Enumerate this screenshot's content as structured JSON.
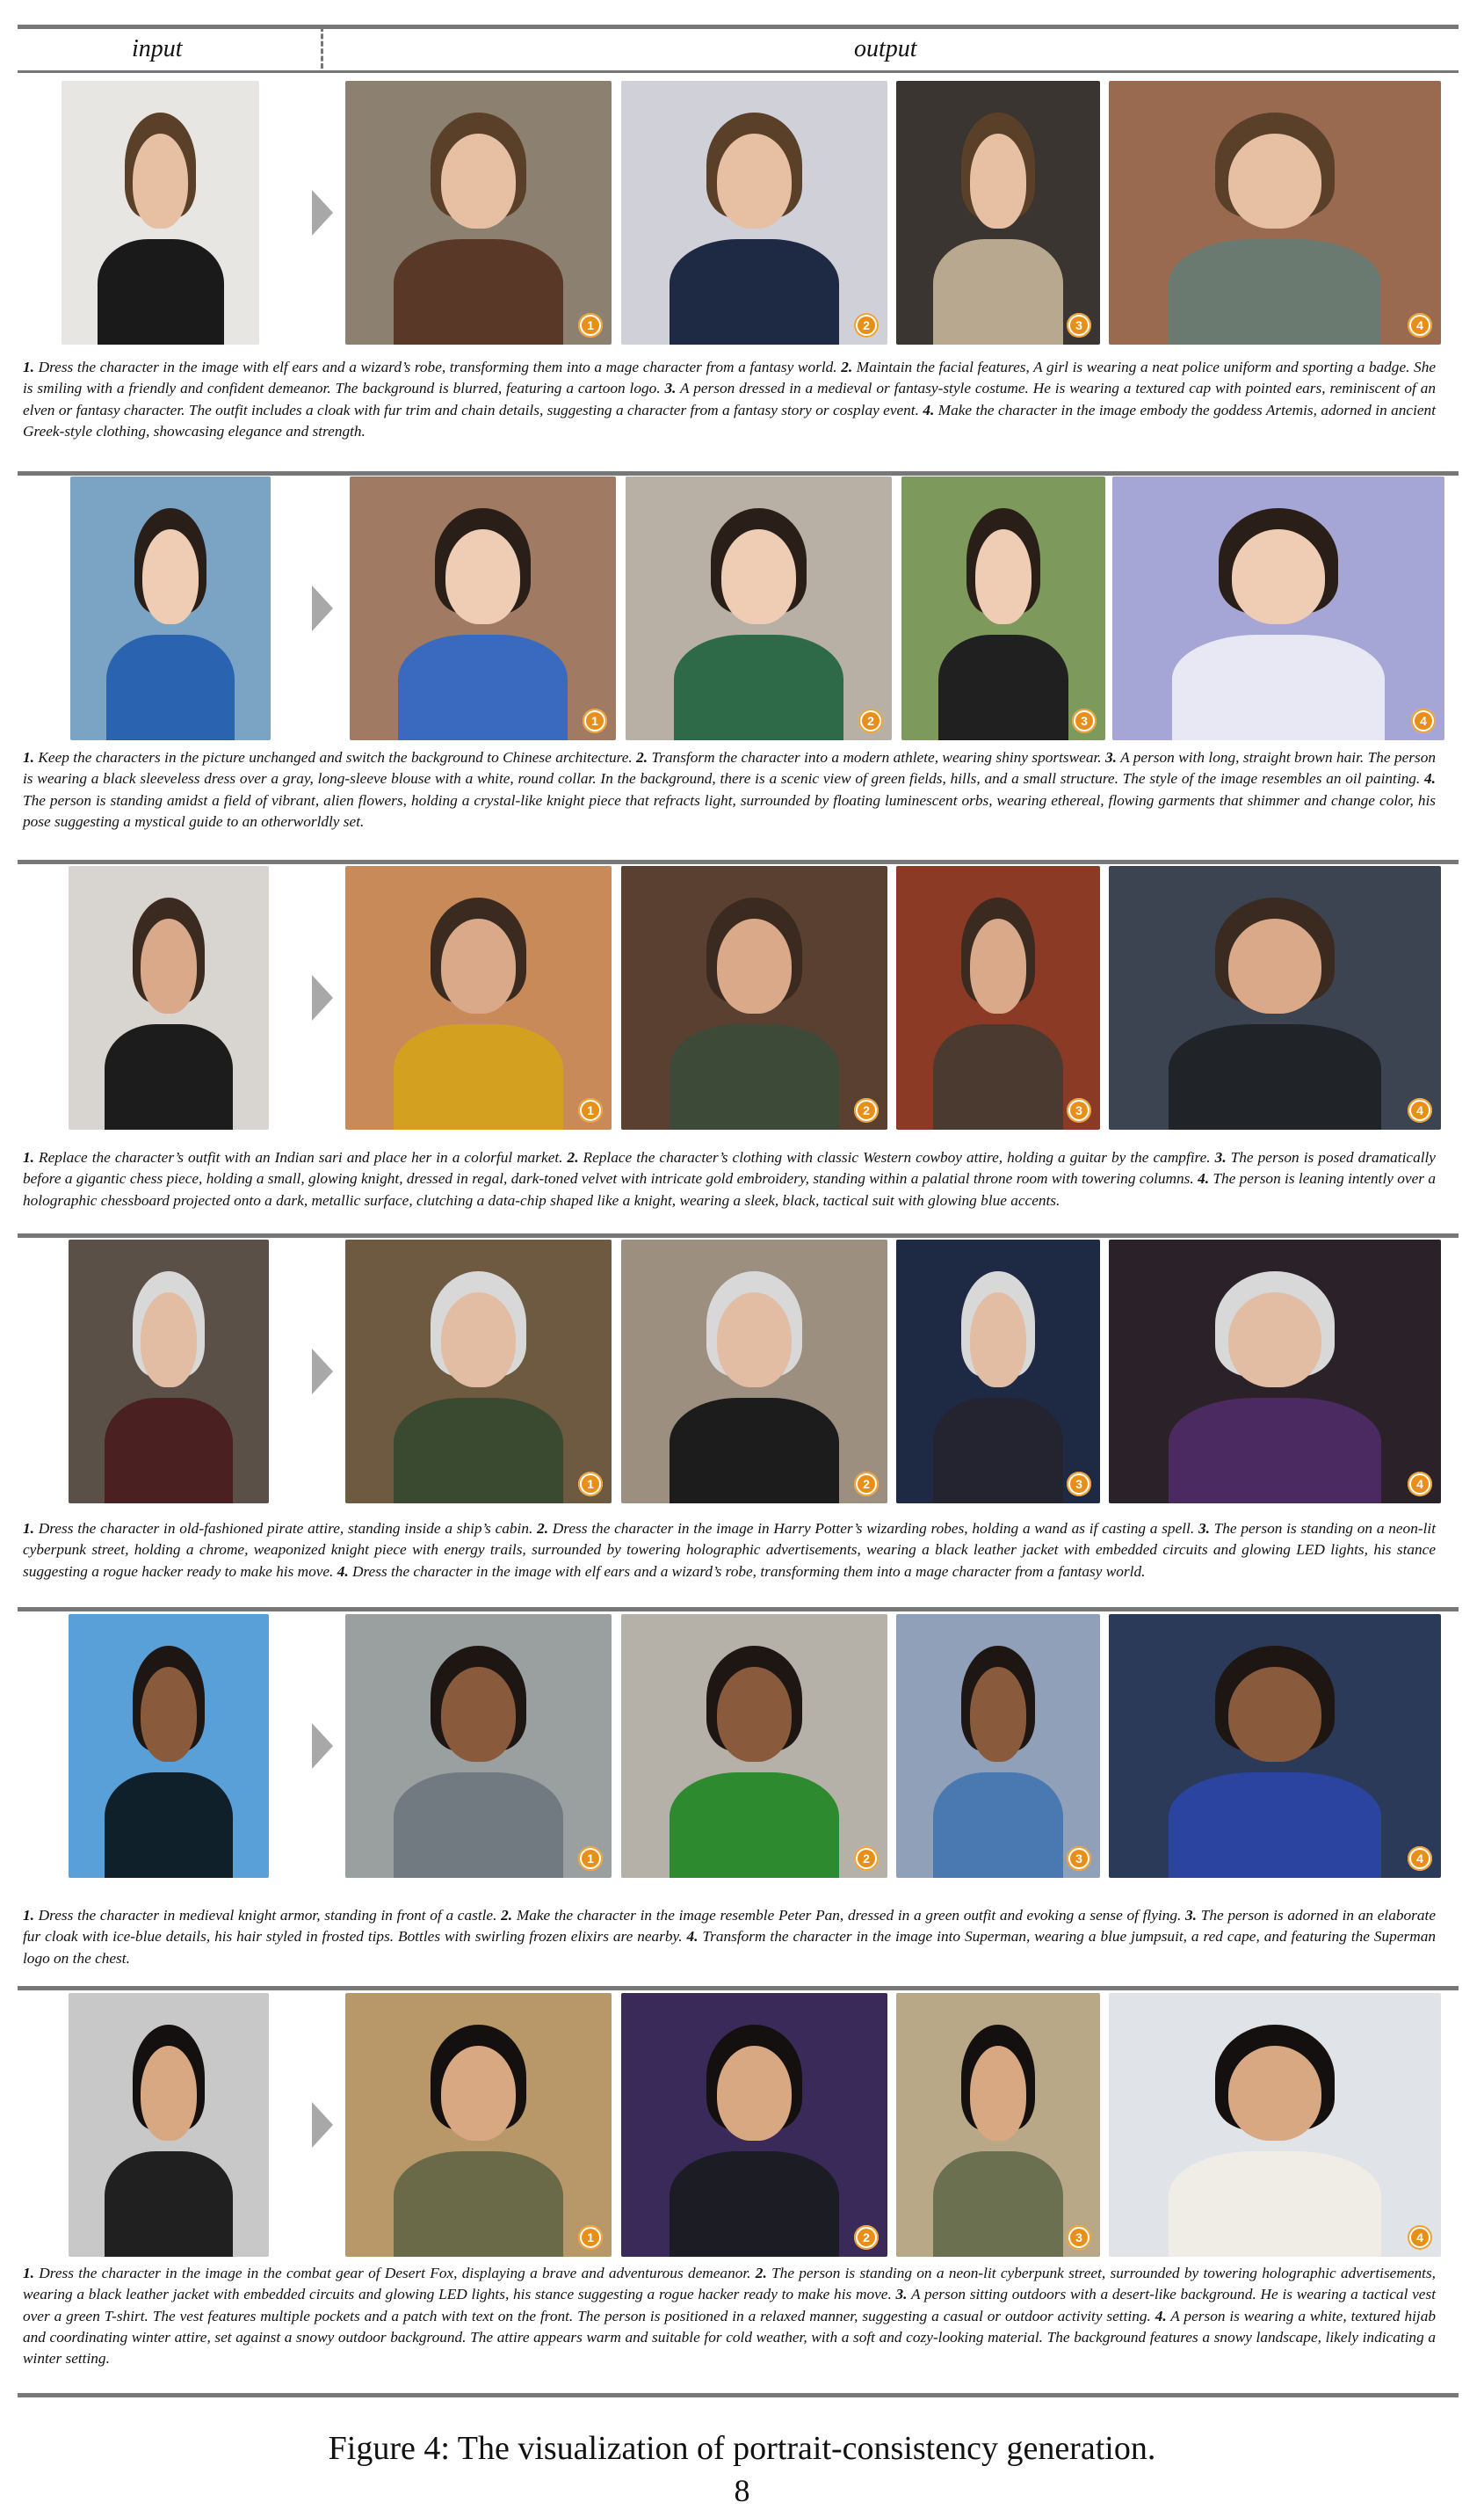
{
  "header": {
    "input_label": "input",
    "output_label": "output"
  },
  "rows": [
    {
      "caption_parts": [
        {
          "n": "1.",
          "t": " Dress the character in the image with elf ears and a wizard’s robe, transforming them into a mage character from a fantasy world. "
        },
        {
          "n": "2.",
          "t": " Maintain the facial features,  A girl is wearing a neat police uniform and sporting a badge. She is smiling with a friendly and confident demeanor. The background is blurred, featuring a cartoon logo. "
        },
        {
          "n": "3.",
          "t": " A person dressed in a medieval or fantasy-style costume. He is wearing a textured cap with pointed ears, reminiscent of an elven or fantasy character. The outfit includes a cloak with fur trim and chain details, suggesting a character from a fantasy story or cosplay event. "
        },
        {
          "n": "4.",
          "t": " Make the character in the image embody the goddess Artemis, adorned in ancient Greek-style clothing, showcasing elegance and strength."
        }
      ],
      "badges": [
        "1",
        "2",
        "3",
        "4"
      ],
      "colors": {
        "input_bg": "#e8e6e2",
        "o1_bg": "#8c8170",
        "o2_bg": "#cfd0d8",
        "o3_bg": "#3a3530",
        "o4_bg": "#9a6a50"
      }
    },
    {
      "caption_parts": [
        {
          "n": "1.",
          "t": " Keep the characters in the picture unchanged and switch the background to Chinese architecture. "
        },
        {
          "n": "2.",
          "t": " Transform the character into a modern athlete, wearing shiny sportswear. "
        },
        {
          "n": "3.",
          "t": " A person with long, straight brown hair. The person is wearing a black sleeveless dress over a gray, long-sleeve blouse with a white, round collar. In the background, there is a scenic view of green fields, hills, and a small structure. The style of the image resembles an oil painting. "
        },
        {
          "n": "4.",
          "t": " The person is standing amidst a field of vibrant, alien flowers, holding a crystal-like knight piece that refracts light, surrounded by floating luminescent orbs, wearing ethereal, flowing garments that shimmer and change color, his pose suggesting a mystical guide to an otherworldly set."
        }
      ],
      "badges": [
        "1",
        "2",
        "3",
        "4"
      ],
      "colors": {
        "input_bg": "#7ba3c4",
        "o1_bg": "#a07a62",
        "o2_bg": "#b8b0a4",
        "o3_bg": "#7d9a5c",
        "o4_bg": "#a6a6d6"
      }
    },
    {
      "caption_parts": [
        {
          "n": "1.",
          "t": " Replace the character’s outfit with an Indian sari and place her in a colorful market.  "
        },
        {
          "n": "2.",
          "t": " Replace the character’s clothing with classic Western cowboy attire, holding a guitar by the campfire. "
        },
        {
          "n": "3.",
          "t": " The person is posed dramatically before a gigantic chess piece, holding a small, glowing knight, dressed in regal, dark-toned velvet with intricate gold embroidery, standing within a palatial throne room with towering columns. "
        },
        {
          "n": "4.",
          "t": " The person is leaning intently over a holographic chessboard projected onto a dark, metallic surface, clutching a data-chip shaped like a knight, wearing a sleek, black, tactical suit with glowing blue accents."
        }
      ],
      "badges": [
        "1",
        "2",
        "3",
        "4"
      ],
      "colors": {
        "input_bg": "#d8d4cf",
        "o1_bg": "#c98a5a",
        "o2_bg": "#5a4030",
        "o3_bg": "#8a3a25",
        "o4_bg": "#3c4452"
      }
    },
    {
      "caption_parts": [
        {
          "n": "1.",
          "t": " Dress the character in old-fashioned pirate attire, standing inside a ship’s cabin. "
        },
        {
          "n": "2.",
          "t": " Dress the character in the image in Harry Potter’s wizarding robes, holding a wand as if casting a spell. "
        },
        {
          "n": "3.",
          "t": " The person is standing on a neon-lit cyberpunk street, holding a chrome, weaponized knight piece with energy trails, surrounded by towering holographic advertisements, wearing a black leather jacket with embedded circuits and glowing LED lights, his stance suggesting a rogue hacker ready to make his move. "
        },
        {
          "n": "4.",
          "t": " Dress the character in the image with elf ears and a wizard’s robe, transforming them into a mage character from a fantasy world."
        }
      ],
      "badges": [
        "1",
        "2",
        "3",
        "4"
      ],
      "colors": {
        "input_bg": "#5a5048",
        "o1_bg": "#6e5a40",
        "o2_bg": "#9c8f80",
        "o3_bg": "#1e2a44",
        "o4_bg": "#2a2228"
      }
    },
    {
      "caption_parts": [
        {
          "n": "1.",
          "t": " Dress the character in medieval knight armor, standing in front of a castle. "
        },
        {
          "n": "2.",
          "t": " Make the character in the image resemble Peter Pan, dressed in a green outfit and evoking a sense of flying. "
        },
        {
          "n": "3.",
          "t": " The person is adorned in an elaborate fur cloak with ice-blue details, his hair styled in frosted tips.  Bottles with swirling frozen elixirs are nearby.  "
        },
        {
          "n": "4.",
          "t": " Transform the character in the image into Superman, wearing a blue jumpsuit, a red cape, and featuring the Superman logo on the chest."
        }
      ],
      "badges": [
        "1",
        "2",
        "3",
        "4"
      ],
      "colors": {
        "input_bg": "#5aa0d8",
        "o1_bg": "#9aa0a0",
        "o2_bg": "#b5b0a8",
        "o3_bg": "#8fa0b8",
        "o4_bg": "#2c3a5a"
      }
    },
    {
      "caption_parts": [
        {
          "n": "1.",
          "t": " Dress the character in the image in the combat gear of Desert Fox, displaying a brave and adventurous demeanor. "
        },
        {
          "n": "2.",
          "t": " The person is standing on a neon-lit cyberpunk street, surrounded by towering holographic advertisements, wearing a black leather jacket with embedded circuits and glowing LED lights, his stance suggesting a rogue hacker ready to make his move. "
        },
        {
          "n": "3.",
          "t": " A person sitting outdoors with a desert-like background. He is wearing a tactical vest over a green T-shirt. The vest features multiple pockets and a patch with text on the front. The person is positioned in a relaxed manner, suggesting a casual or outdoor activity setting. "
        },
        {
          "n": "4.",
          "t": " A person is wearing a white, textured hijab and coordinating winter attire, set against a snowy outdoor background. The attire appears warm and suitable for cold weather, with a soft and cozy-looking material. The background features a snowy landscape, likely indicating a winter setting."
        }
      ],
      "badges": [
        "1",
        "2",
        "3",
        "4"
      ],
      "colors": {
        "input_bg": "#c8c8c8",
        "o1_bg": "#b89868",
        "o2_bg": "#3a2a5a",
        "o3_bg": "#b8a888",
        "o4_bg": "#e0e4e8"
      }
    }
  ],
  "figure_caption": "Figure 4: The visualization of portrait-consistency generation.",
  "page_number": "8"
}
